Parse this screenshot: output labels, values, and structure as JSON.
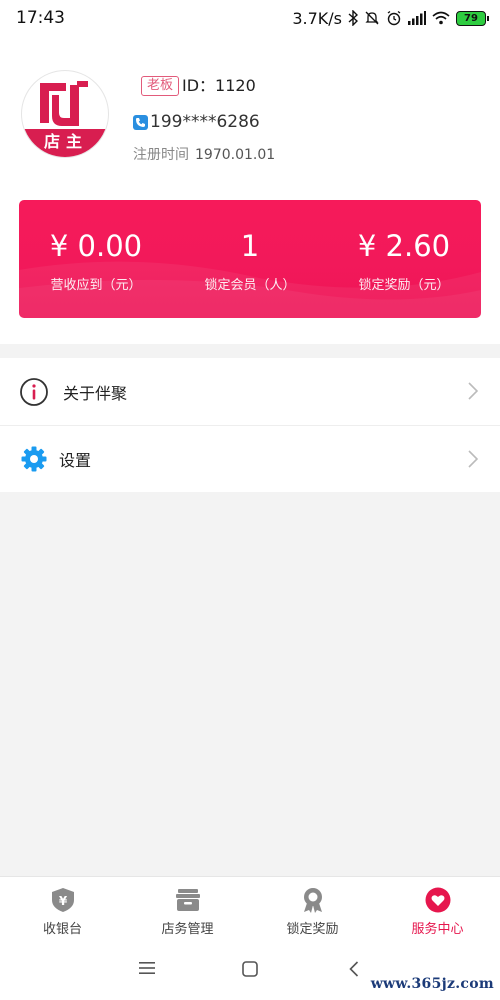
{
  "status_bar": {
    "time": "17:43",
    "network_speed": "3.7K/s",
    "battery": "79",
    "icons": [
      "bluetooth-icon",
      "mute-icon",
      "alarm-icon",
      "signal-icon",
      "wifi-icon",
      "battery-icon"
    ]
  },
  "profile": {
    "avatar_label": "店主",
    "role_badge": "老板",
    "id_label": "ID：1120",
    "phone": "199****6286",
    "register_label": "注册时间",
    "register_date": "1970.01.01"
  },
  "stats": [
    {
      "value": "¥ 0.00",
      "label": "营收应到（元）"
    },
    {
      "value": "1",
      "label": "锁定会员（人）"
    },
    {
      "value": "¥ 2.60",
      "label": "锁定奖励（元）"
    }
  ],
  "menu": {
    "about_label": "关于伴聚",
    "settings_label": "设置"
  },
  "tabs": [
    {
      "label": "收银台",
      "icon": "cashier-icon"
    },
    {
      "label": "店务管理",
      "icon": "store-management-icon"
    },
    {
      "label": "锁定奖励",
      "icon": "award-icon"
    },
    {
      "label": "服务中心",
      "icon": "heart-icon",
      "active": true
    }
  ],
  "colors": {
    "accent": "#f2195a",
    "active_tab": "#e6164d",
    "settings_icon": "#1a9bf0"
  },
  "watermark": "www.365jz.com"
}
